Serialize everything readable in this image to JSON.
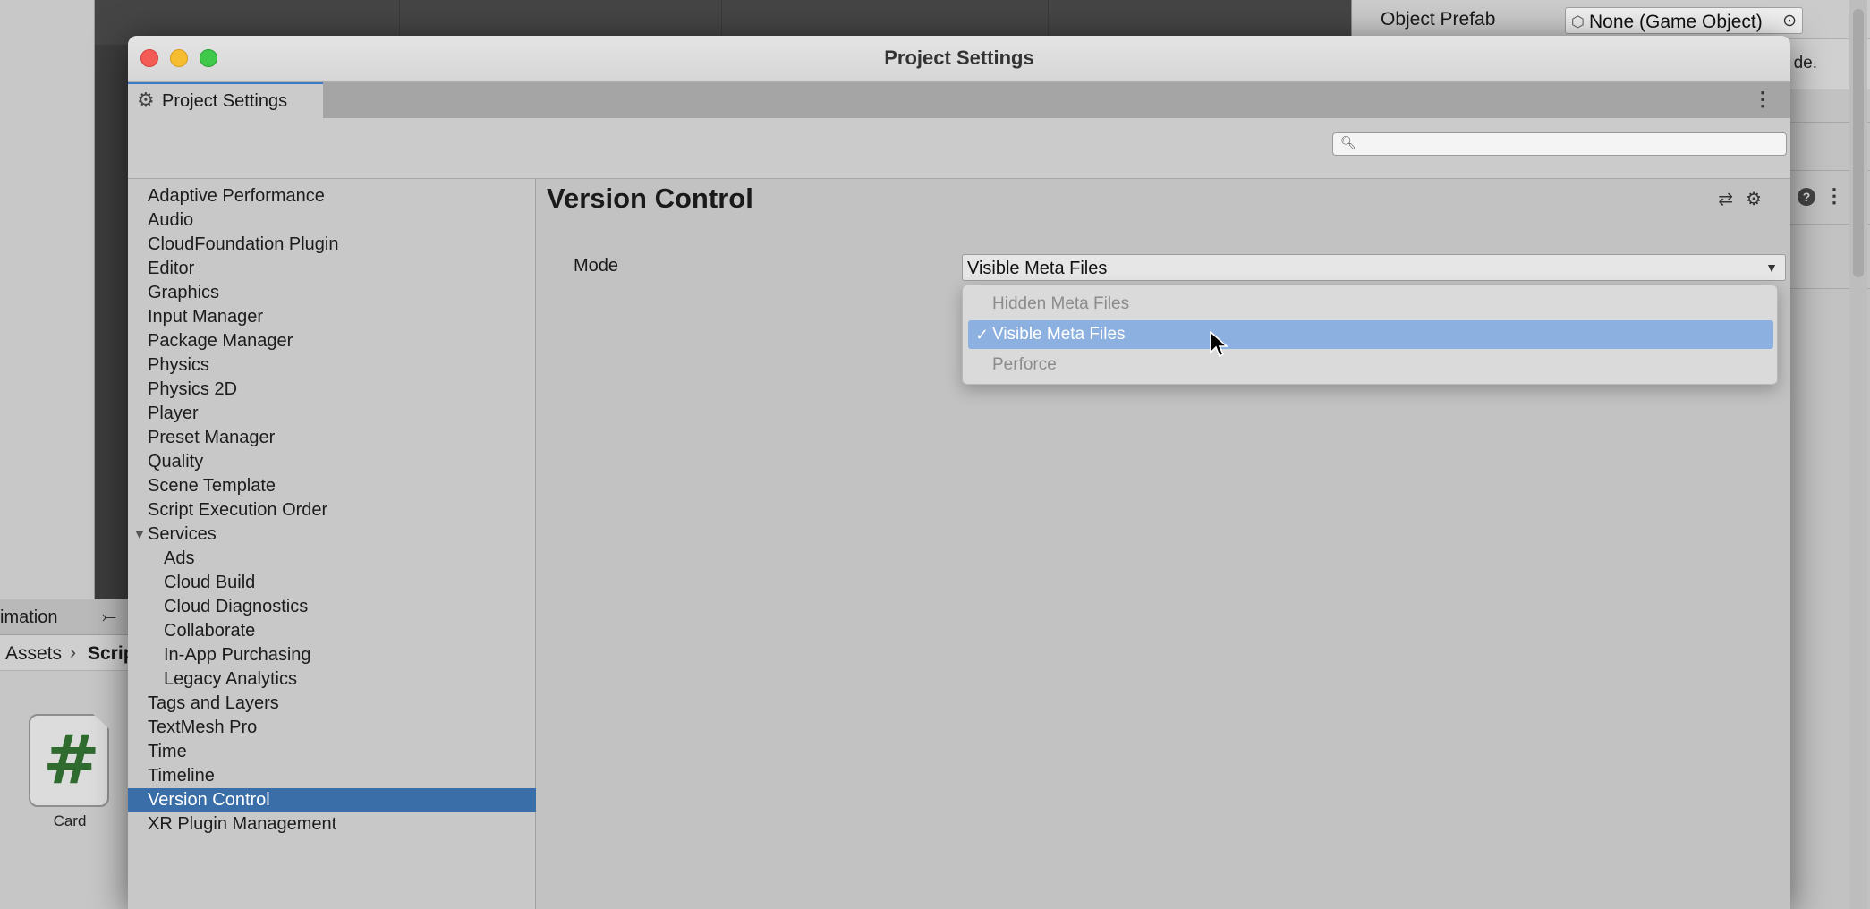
{
  "window": {
    "title": "Project Settings",
    "tab_label": "Project Settings",
    "search_placeholder": ""
  },
  "background": {
    "inspector": {
      "object_prefab_label": "Object Prefab",
      "object_prefab_value": "None (Game Object)",
      "partial_note": "de."
    },
    "project_panel": {
      "tab_label": "imation",
      "breadcrumb": [
        "Assets",
        "Scrip"
      ],
      "asset_label": "Card",
      "asset_glyph": "#"
    }
  },
  "sidebar": {
    "items": [
      {
        "label": "Adaptive Performance",
        "indent": 0
      },
      {
        "label": "Audio",
        "indent": 0
      },
      {
        "label": "CloudFoundation Plugin",
        "indent": 0
      },
      {
        "label": "Editor",
        "indent": 0
      },
      {
        "label": "Graphics",
        "indent": 0
      },
      {
        "label": "Input Manager",
        "indent": 0
      },
      {
        "label": "Package Manager",
        "indent": 0
      },
      {
        "label": "Physics",
        "indent": 0
      },
      {
        "label": "Physics 2D",
        "indent": 0
      },
      {
        "label": "Player",
        "indent": 0
      },
      {
        "label": "Preset Manager",
        "indent": 0
      },
      {
        "label": "Quality",
        "indent": 0
      },
      {
        "label": "Scene Template",
        "indent": 0
      },
      {
        "label": "Script Execution Order",
        "indent": 0
      },
      {
        "label": "Services",
        "indent": 0,
        "expanded": true
      },
      {
        "label": "Ads",
        "indent": 1
      },
      {
        "label": "Cloud Build",
        "indent": 1
      },
      {
        "label": "Cloud Diagnostics",
        "indent": 1
      },
      {
        "label": "Collaborate",
        "indent": 1
      },
      {
        "label": "In-App Purchasing",
        "indent": 1
      },
      {
        "label": "Legacy Analytics",
        "indent": 1
      },
      {
        "label": "Tags and Layers",
        "indent": 0
      },
      {
        "label": "TextMesh Pro",
        "indent": 0
      },
      {
        "label": "Time",
        "indent": 0
      },
      {
        "label": "Timeline",
        "indent": 0
      },
      {
        "label": "Version Control",
        "indent": 0,
        "selected": true
      },
      {
        "label": "XR Plugin Management",
        "indent": 0
      }
    ]
  },
  "panel": {
    "title": "Version Control",
    "mode_label": "Mode",
    "mode_value": "Visible Meta Files",
    "options": [
      {
        "label": "Hidden Meta Files",
        "checked": false,
        "highlighted": false
      },
      {
        "label": "Visible Meta Files",
        "checked": true,
        "highlighted": true
      },
      {
        "label": "Perforce",
        "checked": false,
        "highlighted": false
      }
    ]
  },
  "colors": {
    "selection": "#3a6ea8",
    "highlight": "#8cb0e0",
    "close": "#f25c54",
    "minimize": "#f5bd2f",
    "zoom": "#3fc84a"
  }
}
